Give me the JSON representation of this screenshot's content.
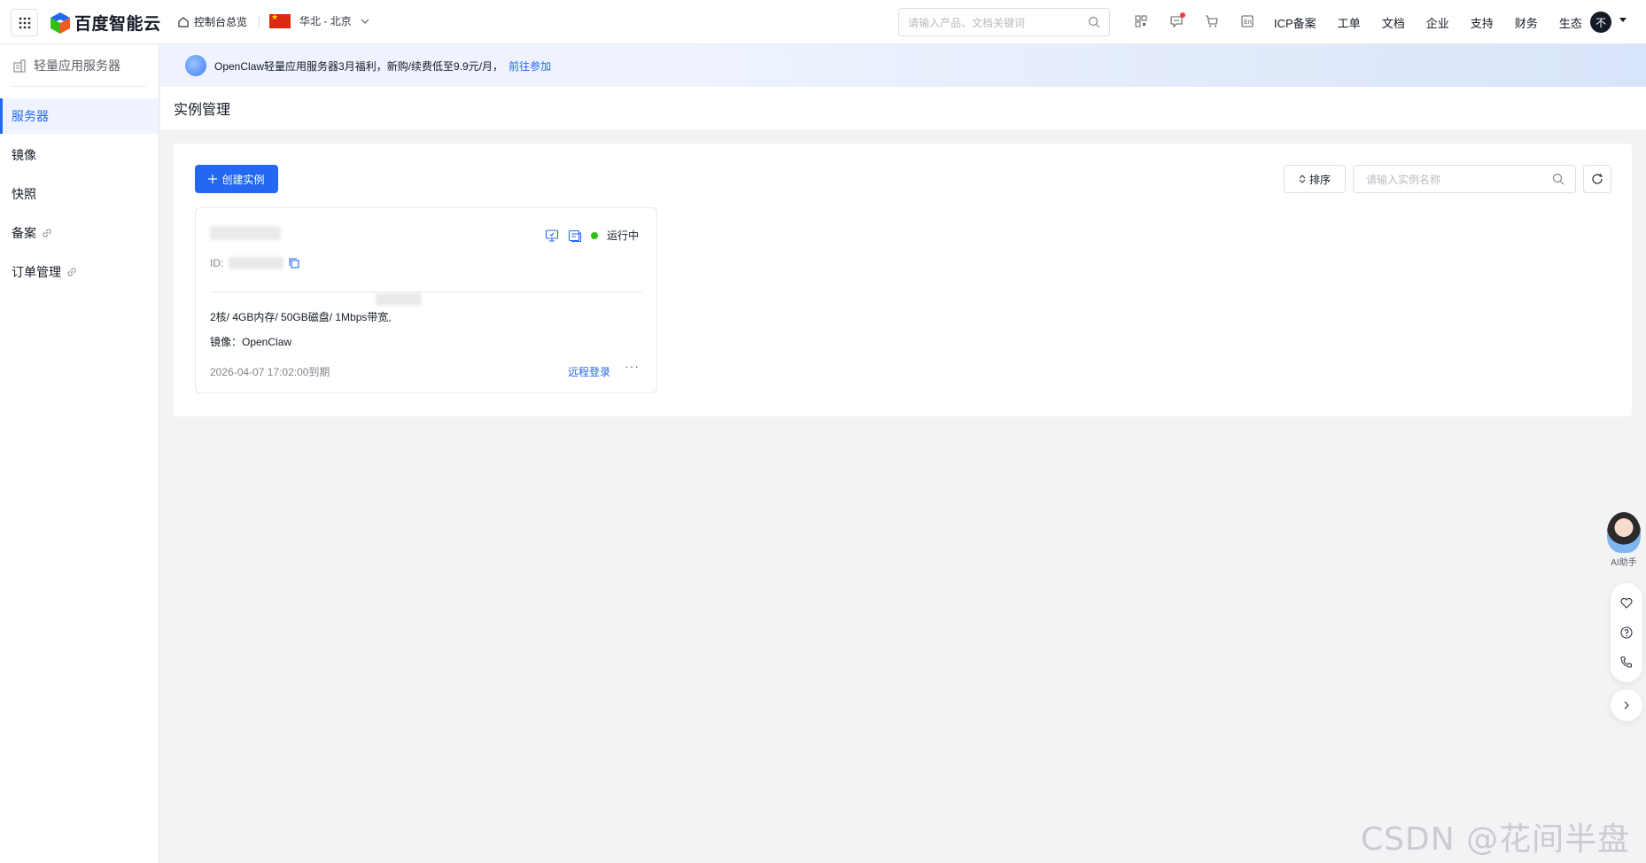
{
  "topbar": {
    "logo_text": "百度智能云",
    "home_label": "控制台总览",
    "region_label": "华北 - 北京",
    "search_placeholder": "请输入产品、文档关键词",
    "links": [
      "ICP备案",
      "工单",
      "文档",
      "企业",
      "支持",
      "财务",
      "生态"
    ],
    "avatar_text": "不"
  },
  "sidebar": {
    "title": "轻量应用服务器",
    "items": [
      {
        "label": "服务器",
        "active": true
      },
      {
        "label": "镜像"
      },
      {
        "label": "快照"
      },
      {
        "label": "备案",
        "link": true
      },
      {
        "label": "订单管理",
        "link": true
      }
    ]
  },
  "banner": {
    "text": "OpenClaw轻量应用服务器3月福利，新购/续费低至9.9元/月，",
    "link": "前往参加"
  },
  "page": {
    "title": "实例管理"
  },
  "toolbar": {
    "create_label": "创建实例",
    "sort_label": "排序",
    "search_placeholder": "请输入实例名称"
  },
  "instance": {
    "id_label": "ID:",
    "status": "运行中",
    "spec": "2核/ 4GB内存/ 50GB磁盘/ 1Mbps带宽,",
    "image_label": "镜像：OpenClaw",
    "expire": "2026-04-07 17:02:00到期",
    "remote_login": "远程登录",
    "more": "···"
  },
  "float_tools": {
    "ai_label": "AI助手"
  },
  "watermark": "CSDN @花间半盘棋",
  "colors": {
    "primary": "#2468f2",
    "status_running": "#30bf13",
    "notification": "#f33e3e"
  }
}
